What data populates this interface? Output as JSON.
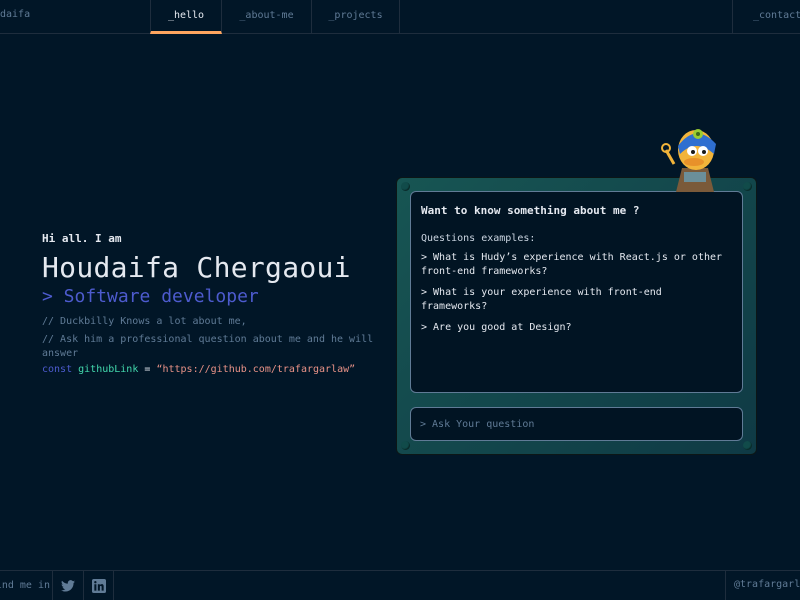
{
  "header": {
    "brand": "daifa",
    "tabs": [
      {
        "label": "_hello",
        "active": true
      },
      {
        "label": "_about-me",
        "active": false
      },
      {
        "label": "_projects",
        "active": false
      }
    ],
    "contact": "_contact-"
  },
  "hero": {
    "greeting": "Hi all. I am",
    "name": "Houdaifa Chergaoui",
    "role": "> Software developer",
    "comment1": "// Duckbilly Knows a lot about me,",
    "comment2": "// Ask him a professional question about me and he will answer",
    "code": {
      "keyword": "const",
      "variable": "githubLink",
      "equals": "=",
      "value": "“https://github.com/trafargarlaw”"
    }
  },
  "chat": {
    "title": "Want to know something about me ?",
    "subtitle": "Questions examples:",
    "questions": [
      "> What is Hudy’s experience with React.js or other front-end frameworks?",
      "> What is your experience with front-end frameworks?",
      "> Are you good at Design?"
    ],
    "input_placeholder": "> Ask Your question"
  },
  "footer": {
    "find_me": "find me in:",
    "handle": "@trafargarlaw"
  },
  "colors": {
    "background": "#011627",
    "accent_orange": "#fea55f",
    "accent_purple": "#4d5bce",
    "accent_teal": "#43d9ad",
    "string": "#e99287",
    "board": "#175553"
  },
  "icons": {
    "mascot": "duck-mascot-icon",
    "twitter": "twitter-icon",
    "linkedin": "linkedin-icon"
  }
}
